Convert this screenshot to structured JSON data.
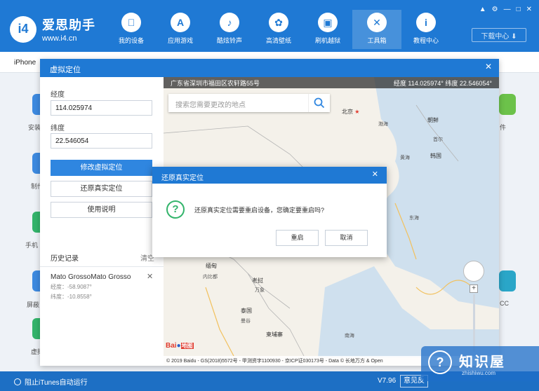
{
  "app": {
    "logo_badge": "i4",
    "logo_name": "爱思助手",
    "logo_url": "www.i4.cn",
    "download_center": "下载中心 ⬇"
  },
  "nav": [
    {
      "label": "我的设备",
      "icon": "apple-icon"
    },
    {
      "label": "应用游戏",
      "icon": "app-store-icon"
    },
    {
      "label": "酷炫铃声",
      "icon": "bell-icon"
    },
    {
      "label": "高清壁纸",
      "icon": "flower-icon"
    },
    {
      "label": "刷机越狱",
      "icon": "box-icon"
    },
    {
      "label": "工具箱",
      "icon": "tools-icon"
    },
    {
      "label": "教程中心",
      "icon": "info-icon"
    }
  ],
  "device_tab": "iPhone",
  "background_labels": {
    "l1": "安装",
    "l2": "制作",
    "l3": "手机",
    "l4": "屏蔽",
    "l5": "虚拟",
    "r1": "件",
    "r2": "CC"
  },
  "status_bar": {
    "itunes": "阻止iTunes自动运行",
    "version": "V7.96",
    "feedback": "意见反"
  },
  "virtual_location": {
    "title": "虚拟定位",
    "longitude_label": "经度",
    "longitude_value": "114.025974",
    "latitude_label": "纬度",
    "latitude_value": "22.546054",
    "modify_button": "修改虚拟定位",
    "restore_button": "还原真实定位",
    "help_button": "使用说明",
    "history_title": "历史记录",
    "history_clear": "清空",
    "history_items": [
      {
        "name": "Mato GrossoMato Grosso",
        "lng": "经度：-58.9087°",
        "lat": "纬度：-10.8558°"
      }
    ]
  },
  "map": {
    "address": "广东省深圳市福田区农轩路55号",
    "coords": "经度 114.025974°   纬度 22.546054°",
    "search_placeholder": "搜索您需要更改的地点",
    "labels": {
      "beijing": "北京",
      "bohai": "渤海",
      "chaoxian": "朝鲜",
      "shouer": "首尔",
      "hanguo": "韩国",
      "huanghai": "黄海",
      "donghai": "东海",
      "miandian": "缅甸",
      "neibidu": "内比都",
      "laowo": "老挝",
      "wanxiang": "万象",
      "taiguo": "泰国",
      "mangu": "曼谷",
      "jianpuzhai": "柬埔寨",
      "nanhai": "南海"
    },
    "baidu": "Bai",
    "baidu_map": "地图",
    "footer": "© 2019 Baidu - GS(2018)5572号 - 甲测资字1100930 - 京ICP证030173号 - Data © 长地万方 & Open"
  },
  "restore_dialog": {
    "title": "还原真实定位",
    "message": "还原真实定位需要重启设备，您确定要重启吗?",
    "restart": "重启",
    "cancel": "取消"
  },
  "watermark": {
    "name": "知识屋",
    "url": "zhishiwu.com"
  }
}
